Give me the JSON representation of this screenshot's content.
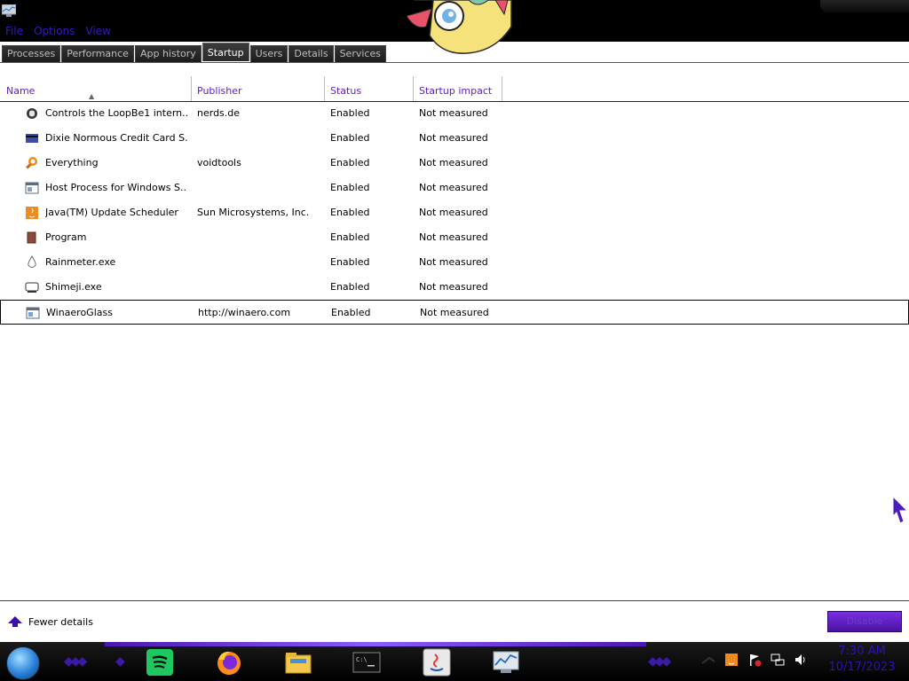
{
  "menu": [
    "File",
    "Options",
    "View"
  ],
  "tabs": [
    "Processes",
    "Performance",
    "App history",
    "Startup",
    "Users",
    "Details",
    "Services"
  ],
  "active_tab": "Startup",
  "columns": {
    "name": "Name",
    "publisher": "Publisher",
    "status": "Status",
    "impact": "Startup impact"
  },
  "rows": [
    {
      "name": "Controls the LoopBe1 intern...",
      "publisher": "nerds.de",
      "status": "Enabled",
      "impact": "Not measured",
      "icon": "loopbe-icon"
    },
    {
      "name": "Dixie Normous Credit Card S...",
      "publisher": "",
      "status": "Enabled",
      "impact": "Not measured",
      "icon": "credit-card-icon"
    },
    {
      "name": "Everything",
      "publisher": "voidtools",
      "status": "Enabled",
      "impact": "Not measured",
      "icon": "search-magnifier-icon"
    },
    {
      "name": "Host Process for Windows S...",
      "publisher": "",
      "status": "Enabled",
      "impact": "Not measured",
      "icon": "window-app-icon"
    },
    {
      "name": "Java(TM) Update Scheduler",
      "publisher": "Sun Microsystems, Inc.",
      "status": "Enabled",
      "impact": "Not measured",
      "icon": "java-icon"
    },
    {
      "name": "Program",
      "publisher": "",
      "status": "Enabled",
      "impact": "Not measured",
      "icon": "program-icon"
    },
    {
      "name": "Rainmeter.exe",
      "publisher": "",
      "status": "Enabled",
      "impact": "Not measured",
      "icon": "raindrop-icon"
    },
    {
      "name": "Shimeji.exe",
      "publisher": "",
      "status": "Enabled",
      "impact": "Not measured",
      "icon": "shimeji-icon"
    },
    {
      "name": "WinaeroGlass",
      "publisher": "http://winaero.com",
      "status": "Enabled",
      "impact": "Not measured",
      "icon": "window-app-icon"
    }
  ],
  "selected_row": "WinaeroGlass",
  "footer": {
    "fewer_details": "Fewer details",
    "disable": "Disable"
  },
  "taskbar": {
    "apps": [
      "spotify-icon",
      "firefox-icon",
      "file-explorer-icon",
      "command-prompt-icon",
      "java-icon",
      "task-manager-icon"
    ],
    "tray": [
      "network-icon",
      "java-icon",
      "action-center-flag-icon",
      "network-wired-icon",
      "volume-icon"
    ],
    "time": "7:30 AM",
    "date": "10/17/2023"
  },
  "colors": {
    "accent": "#5c1cc6",
    "menu": "#3a16c9",
    "disable_button": "#5a1fc4"
  }
}
